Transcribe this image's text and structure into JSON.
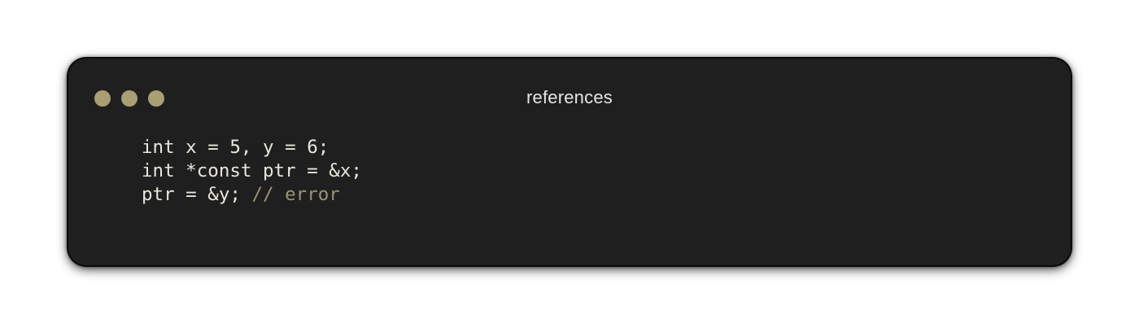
{
  "window": {
    "title": "references",
    "dots": [
      {
        "name": "window-dot-1",
        "color": "#a89f72"
      },
      {
        "name": "window-dot-2",
        "color": "#a89f72"
      },
      {
        "name": "window-dot-3",
        "color": "#a89f72"
      }
    ]
  },
  "colors": {
    "background": "#1f1f1f",
    "text": "#e8e6dc",
    "comment": "#9b9475"
  },
  "code": {
    "language": "c",
    "lines": [
      {
        "parts": [
          {
            "text": "int x = 5, y = 6;",
            "kind": "code"
          }
        ]
      },
      {
        "parts": [
          {
            "text": "int *const ptr = &x;",
            "kind": "code"
          }
        ]
      },
      {
        "parts": [
          {
            "text": "ptr = &y; ",
            "kind": "code"
          },
          {
            "text": "// error",
            "kind": "comment"
          }
        ]
      }
    ]
  }
}
